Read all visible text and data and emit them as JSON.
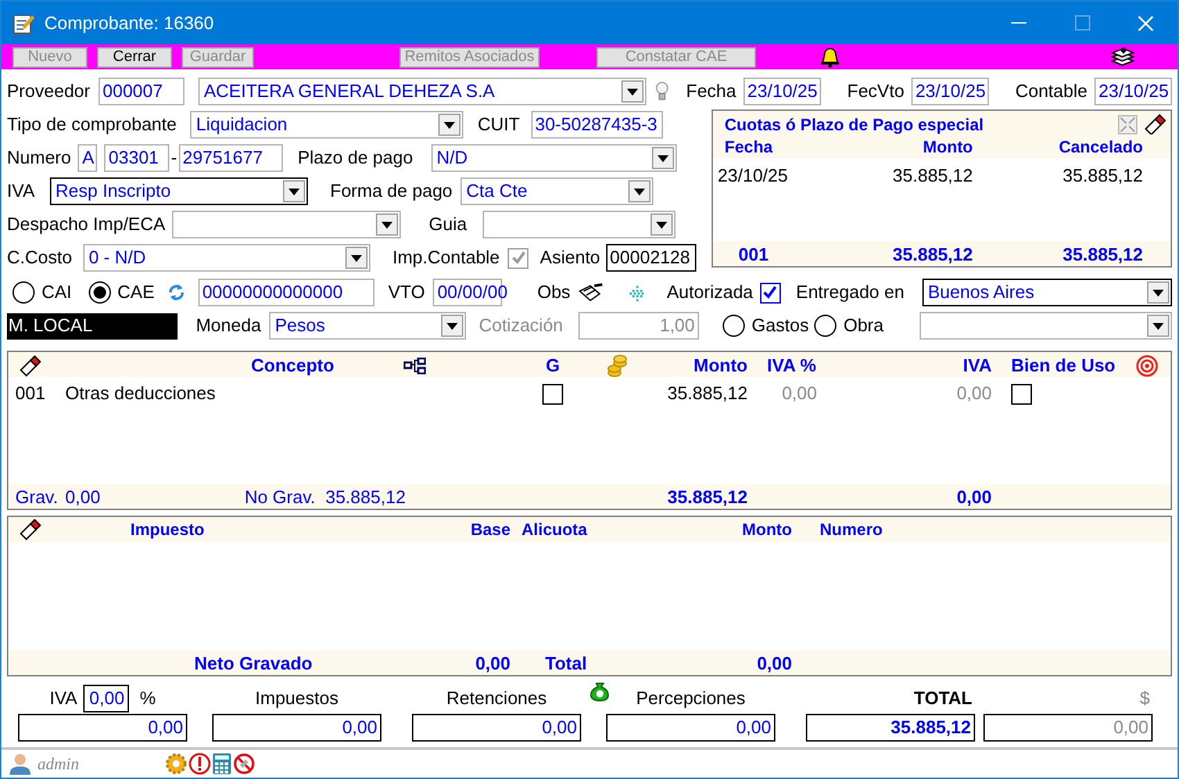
{
  "window": {
    "title": "Comprobante: 16360"
  },
  "toolbar": {
    "main": [
      {
        "label": "Nuevo",
        "disabled": true
      },
      {
        "label": "Cerrar",
        "disabled": false
      },
      {
        "label": "Guardar",
        "disabled": true
      }
    ],
    "links": [
      {
        "label": "Remitos Asociados",
        "disabled": true
      },
      {
        "label": "Constatar CAE",
        "disabled": true
      }
    ]
  },
  "proveedor": {
    "label": "Proveedor",
    "code": "000007",
    "name": "ACEITERA GENERAL DEHEZA S.A"
  },
  "dates": [
    {
      "label": "Fecha",
      "value": "23/10/25"
    },
    {
      "label": "FecVto",
      "value": "23/10/25"
    },
    {
      "label": "Contable",
      "value": "23/10/25"
    }
  ],
  "tipo": {
    "label": "Tipo de comprobante",
    "value": "Liquidacion"
  },
  "cuit": {
    "label": "CUIT",
    "value": "30-50287435-3"
  },
  "numero": {
    "label": "Numero",
    "letra": "A",
    "punto": "03301",
    "separator": "-",
    "nro": "29751677"
  },
  "plazo": {
    "label": "Plazo de pago",
    "value": "N/D"
  },
  "iva": {
    "label": "IVA",
    "value": "Resp Inscripto"
  },
  "forma_pago": {
    "label": "Forma de pago",
    "value": "Cta Cte"
  },
  "despacho": {
    "label": "Despacho Imp/ECA"
  },
  "guia": {
    "label": "Guia"
  },
  "ccosto": {
    "label": "C.Costo",
    "value": "0 - N/D"
  },
  "imp_contable": {
    "label": "Imp.Contable",
    "checked": true,
    "disabled": true
  },
  "asiento": {
    "label": "Asiento",
    "value": "00002128"
  },
  "cuotas": {
    "title": "Cuotas ó Plazo de Pago especial",
    "columns": [
      "Fecha",
      "Monto",
      "Cancelado"
    ],
    "rows": [
      [
        "23/10/25",
        "35.885,12",
        "35.885,12"
      ]
    ],
    "footer": [
      "001",
      "35.885,12",
      "35.885,12"
    ]
  },
  "autorizacion": [
    {
      "label": "CAI",
      "selected": false
    },
    {
      "label": "CAE",
      "selected": true
    }
  ],
  "cae_number": "00000000000000",
  "vto": {
    "label": "VTO",
    "value": "00/00/00"
  },
  "obs": {
    "label": "Obs"
  },
  "autorizada": {
    "label": "Autorizada",
    "checked": true
  },
  "entregado": {
    "label": "Entregado en",
    "value": "Buenos Aires"
  },
  "moneda_local": "M. LOCAL",
  "moneda": {
    "label": "Moneda",
    "value": "Pesos"
  },
  "cotizacion": {
    "label": "Cotización",
    "value": "1,00",
    "disabled": true
  },
  "destino": [
    {
      "label": "Gastos",
      "selected": false
    },
    {
      "label": "Obra",
      "selected": false
    }
  ],
  "conceptos": {
    "columns": {
      "concepto": "Concepto",
      "g": "G",
      "monto": "Monto",
      "iva_pct": "IVA %",
      "iva": "IVA",
      "bien_de_uso": "Bien de Uso"
    },
    "rows": [
      {
        "code": "001",
        "concepto": "Otras deducciones",
        "g": false,
        "monto": "35.885,12",
        "iva_pct": "0,00",
        "iva": "0,00",
        "bien_de_uso": false
      }
    ],
    "footer": {
      "grav_label": "Grav.",
      "grav": "0,00",
      "nograv": "No Grav.  35.885,12",
      "monto": "35.885,12",
      "iva": "0,00"
    }
  },
  "impuestos": {
    "columns": {
      "impuesto": "Impuesto",
      "base": "Base",
      "alicuota": "Alicuota",
      "monto": "Monto",
      "numero": "Numero"
    },
    "footer": {
      "neto_label": "Neto Gravado",
      "base": "0,00",
      "total_label": "Total",
      "monto": "0,00"
    }
  },
  "totals": {
    "iva_label": "IVA",
    "iva_pct": "0,00",
    "pct_sign": "%",
    "items": [
      {
        "label": "Impuestos",
        "value": "0,00"
      },
      {
        "label": "Retenciones",
        "value": "0,00"
      },
      {
        "label": "Percepciones",
        "value": "0,00"
      },
      {
        "label": "TOTAL",
        "value": "35.885,12",
        "kind": "total"
      },
      {
        "label": "$",
        "value": "0,00",
        "kind": "currency"
      }
    ],
    "iva_value": "0,00"
  },
  "status_bar": {
    "user": "admin"
  }
}
